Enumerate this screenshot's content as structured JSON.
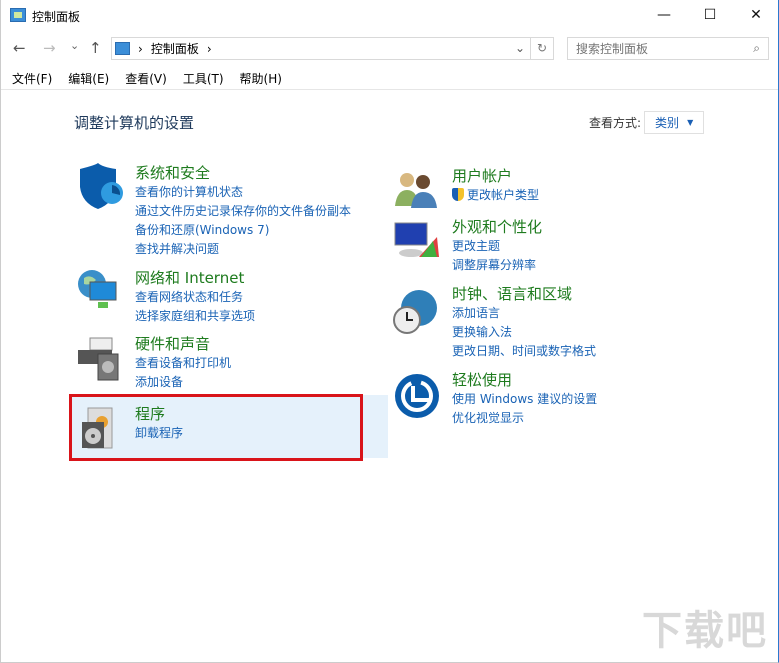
{
  "window": {
    "title": "控制面板",
    "minimize": "—",
    "maximize": "☐",
    "close": "✕"
  },
  "nav": {
    "back": "←",
    "forward": "→",
    "recent": "⌄",
    "up": "↑",
    "breadcrumb": "控制面板",
    "sep": "›",
    "dropdown": "⌄",
    "refresh": "↻",
    "search_placeholder": "搜索控制面板",
    "search_icon": "⌕"
  },
  "menu": [
    "文件(F)",
    "编辑(E)",
    "查看(V)",
    "工具(T)",
    "帮助(H)"
  ],
  "main": {
    "heading": "调整计算机的设置",
    "view_by_label": "查看方式:",
    "view_by_value": "类别",
    "view_by_arrow": "▼"
  },
  "categories": [
    {
      "title": "系统和安全",
      "icon": "shield-icon",
      "links": [
        "查看你的计算机状态",
        "通过文件历史记录保存你的文件备份副本",
        "备份和还原(Windows 7)",
        "查找并解决问题"
      ]
    },
    {
      "title": "网络和 Internet",
      "icon": "network-icon",
      "links": [
        "查看网络状态和任务",
        "选择家庭组和共享选项"
      ]
    },
    {
      "title": "硬件和声音",
      "icon": "printer-icon",
      "links": [
        "查看设备和打印机",
        "添加设备"
      ]
    },
    {
      "title": "程序",
      "icon": "programs-icon",
      "links": [
        "卸载程序"
      ]
    },
    {
      "title": "用户帐户",
      "icon": "users-icon",
      "links": [
        "更改帐户类型"
      ]
    },
    {
      "title": "外观和个性化",
      "icon": "appearance-icon",
      "links": [
        "更改主题",
        "调整屏幕分辨率"
      ]
    },
    {
      "title": "时钟、语言和区域",
      "icon": "clock-globe-icon",
      "links": [
        "添加语言",
        "更换输入法",
        "更改日期、时间或数字格式"
      ]
    },
    {
      "title": "轻松使用",
      "icon": "ease-of-access-icon",
      "links": [
        "使用 Windows 建议的设置",
        "优化视觉显示"
      ]
    }
  ],
  "watermark": "下载吧"
}
